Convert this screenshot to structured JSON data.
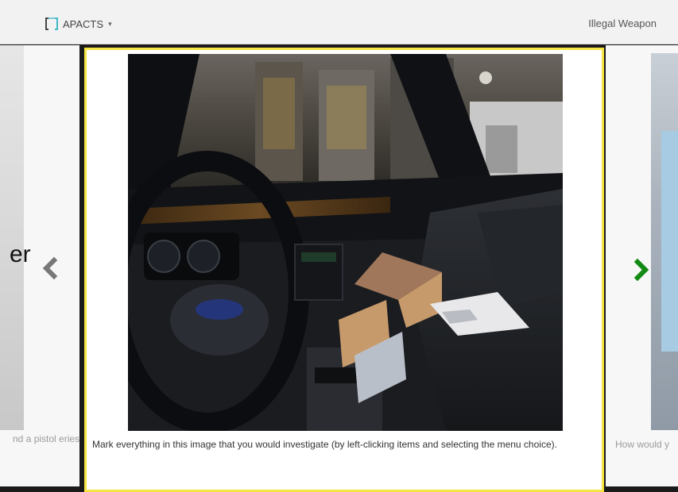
{
  "navbar": {
    "brand": "APACTS",
    "brand_caret": "▾",
    "scenario_title": "Illegal Weapon"
  },
  "carousel": {
    "left_slide": {
      "peek_text": "er",
      "caption": "nd a pistol eries."
    },
    "center_slide": {
      "caption": "Mark everything in this image that you would investigate (by left-clicking items and selecting the menu choice)."
    },
    "right_slide": {
      "caption": "How would y"
    },
    "prev_icon": "chevron-left-icon",
    "next_icon": "chevron-right-icon",
    "colors": {
      "active_border": "#f4e542",
      "next_arrow": "#138a13",
      "prev_arrow": "#777777"
    }
  }
}
